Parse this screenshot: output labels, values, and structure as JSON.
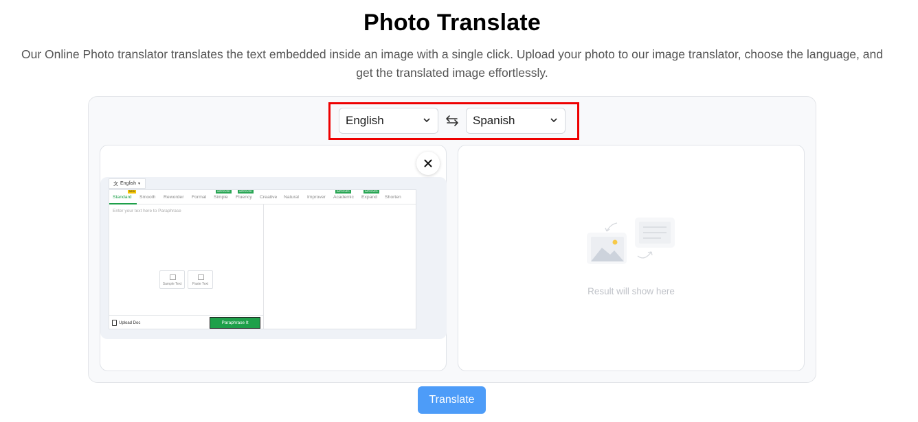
{
  "header": {
    "title": "Photo Translate",
    "subtitle": "Our Online Photo translator translates the text embedded inside an image with a single click. Upload your photo to our image translator, choose the language, and get the translated image effortlessly."
  },
  "languages": {
    "source": "English",
    "target": "Spanish",
    "swap_icon": "swap-arrows-icon",
    "highlight_color": "#ee0000"
  },
  "preview": {
    "language_tab": "English",
    "modes": [
      {
        "label": "Standard",
        "badge": "NEW"
      },
      {
        "label": "Smooth",
        "badge": ""
      },
      {
        "label": "Reworder",
        "badge": ""
      },
      {
        "label": "Formal",
        "badge": ""
      },
      {
        "label": "Simple",
        "badge": "IMPROVED"
      },
      {
        "label": "Fluency",
        "badge": "IMPROVED"
      },
      {
        "label": "Creative",
        "badge": ""
      },
      {
        "label": "Natural",
        "badge": ""
      },
      {
        "label": "Improver",
        "badge": ""
      },
      {
        "label": "Academic",
        "badge": "IMPROVED"
      },
      {
        "label": "Expand",
        "badge": "IMPROVED"
      },
      {
        "label": "Shorten",
        "badge": ""
      }
    ],
    "placeholder": "Enter your text here to Paraphrase",
    "sample_text": "Sample Text",
    "paste_text": "Paste Text",
    "upload_doc": "Upload Doc",
    "paraphrase_button": "Paraphrase It",
    "accent_color": "#1ea04a"
  },
  "result": {
    "placeholder": "Result will show here"
  },
  "actions": {
    "translate_label": "Translate",
    "button_color": "#4d9cf8"
  }
}
